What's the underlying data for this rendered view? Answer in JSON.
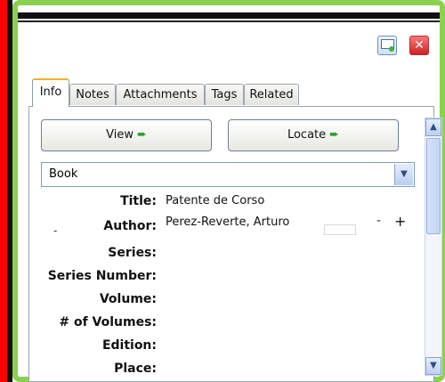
{
  "tabs": [
    "Info",
    "Notes",
    "Attachments",
    "Tags",
    "Related"
  ],
  "buttons": {
    "view": "View",
    "locate": "Locate",
    "arrow": "➨"
  },
  "item_type": "Book",
  "fields": [
    {
      "label": "Title:",
      "value": "Patente de Corso"
    },
    {
      "label": "Author:",
      "value": "Perez-Reverte,   Arturo"
    },
    {
      "label": "Series:",
      "value": ""
    },
    {
      "label": "Series Number:",
      "value": ""
    },
    {
      "label": "Volume:",
      "value": ""
    },
    {
      "label": "# of Volumes:",
      "value": ""
    },
    {
      "label": "Edition:",
      "value": ""
    },
    {
      "label": "Place:",
      "value": ""
    }
  ],
  "author_controls": {
    "minus": "-",
    "plus": "+",
    "bullet": "-"
  },
  "glyphs": {
    "dropdown": "▼",
    "up": "▲",
    "down": "▼",
    "close": "✕"
  },
  "colors": {
    "highlight_border": "#8cd04f",
    "red_bar": "#ff0000",
    "active_tab_accent": "#f0b030"
  }
}
